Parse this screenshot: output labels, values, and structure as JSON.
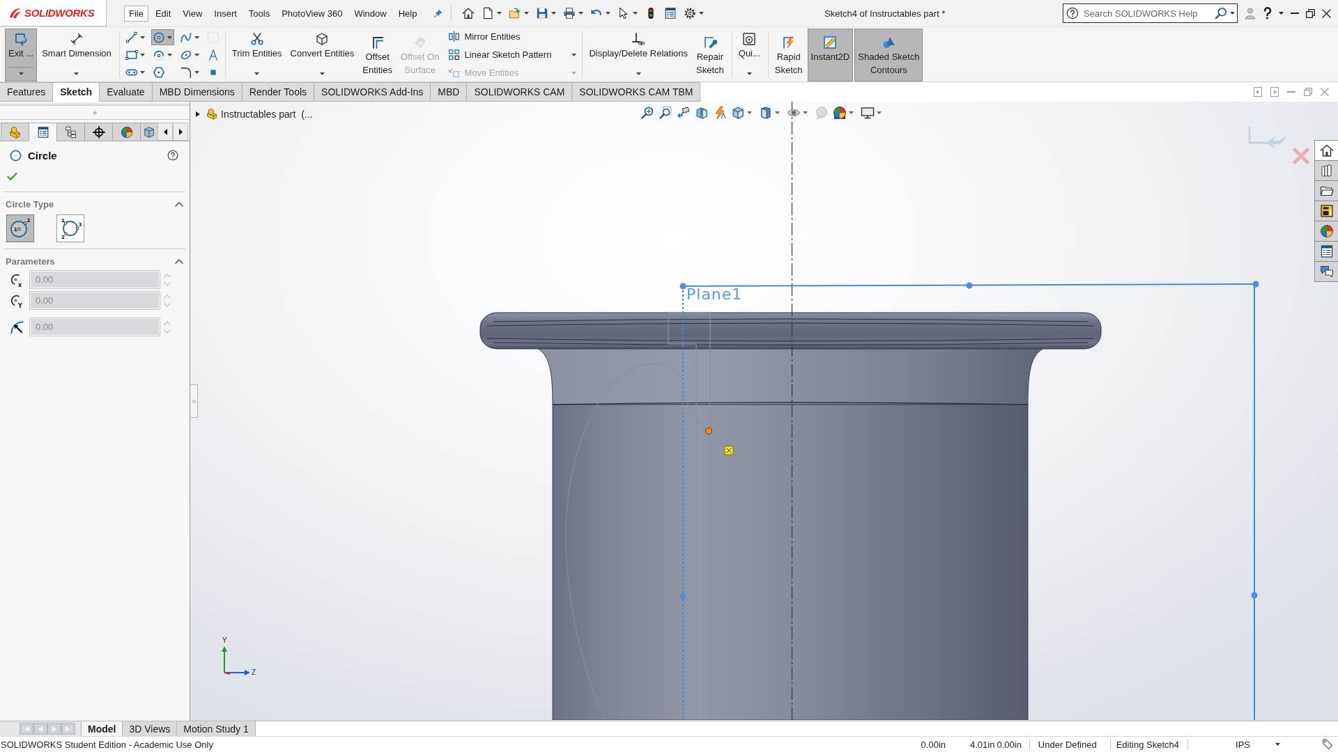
{
  "app": {
    "logo": "SOLIDWORKS"
  },
  "menu": [
    {
      "label": "File",
      "selected": true
    },
    {
      "label": "Edit",
      "selected": false
    },
    {
      "label": "View",
      "selected": false
    },
    {
      "label": "Insert",
      "selected": false
    },
    {
      "label": "Tools",
      "selected": false
    },
    {
      "label": "PhotoView 360",
      "selected": false
    },
    {
      "label": "Window",
      "selected": false
    },
    {
      "label": "Help",
      "selected": false
    }
  ],
  "window": {
    "title": "Sketch4 of Instructables part *"
  },
  "search": {
    "placeholder": "Search SOLIDWORKS Help"
  },
  "ribbon": [
    {
      "buttons": [
        {
          "kind": "exit",
          "lines": [
            "Exit ..."
          ],
          "active": true,
          "disabled": false,
          "dropdown": true
        },
        {
          "kind": "dimension",
          "lines": [
            "Smart Dimension"
          ],
          "active": false,
          "disabled": false,
          "dropdown": true
        }
      ]
    },
    {
      "tools": [
        {
          "kind": "line",
          "active": false,
          "disabled": false,
          "dropdown": true
        },
        {
          "kind": "circle",
          "active": true,
          "disabled": false,
          "dropdown": true
        },
        {
          "kind": "spline",
          "active": false,
          "disabled": false,
          "dropdown": true
        },
        {
          "kind": "construction",
          "active": false,
          "disabled": true,
          "dropdown": false
        },
        {
          "kind": "rectangle",
          "active": false,
          "disabled": false,
          "dropdown": true
        },
        {
          "kind": "arc",
          "active": false,
          "disabled": false,
          "dropdown": true
        },
        {
          "kind": "ellipse",
          "active": false,
          "disabled": false,
          "dropdown": true
        },
        {
          "kind": "text",
          "active": false,
          "disabled": false,
          "dropdown": false
        },
        {
          "kind": "slot",
          "active": false,
          "disabled": false,
          "dropdown": true
        },
        {
          "kind": "polygon",
          "active": false,
          "disabled": false,
          "dropdown": false
        },
        {
          "kind": "fillet",
          "active": false,
          "disabled": false,
          "dropdown": true
        },
        {
          "kind": "point",
          "active": false,
          "disabled": false,
          "dropdown": false
        }
      ]
    },
    {
      "buttons": [
        {
          "kind": "trim",
          "lines": [
            "Trim Entities"
          ],
          "active": false,
          "disabled": false,
          "dropdown": true
        },
        {
          "kind": "convert",
          "lines": [
            "Convert Entities"
          ],
          "active": false,
          "disabled": false,
          "dropdown": true
        },
        {
          "kind": "offset",
          "lines": [
            "Offset",
            "Entities"
          ],
          "active": false,
          "disabled": false,
          "dropdown": false
        },
        {
          "kind": "surface",
          "lines": [
            "Offset On",
            "Surface"
          ],
          "active": false,
          "disabled": true,
          "dropdown": false
        }
      ],
      "rows": [
        {
          "kind": "mirror",
          "label": "Mirror Entities",
          "disabled": false,
          "dropdown": false
        },
        {
          "kind": "pattern",
          "label": "Linear Sketch Pattern",
          "disabled": false,
          "dropdown": true
        },
        {
          "kind": "move",
          "label": "Move Entities",
          "disabled": true,
          "dropdown": true
        }
      ]
    },
    {
      "buttons": [
        {
          "kind": "relations",
          "lines": [
            "Display/Delete Relations"
          ],
          "active": false,
          "disabled": false,
          "dropdown": true
        },
        {
          "kind": "repair",
          "lines": [
            "Repair",
            "Sketch"
          ],
          "active": false,
          "disabled": false,
          "dropdown": false
        }
      ]
    },
    {
      "buttons": [
        {
          "kind": "snaps",
          "lines": [
            "Qui..."
          ],
          "active": false,
          "disabled": false,
          "dropdown": true
        }
      ]
    },
    {
      "buttons": [
        {
          "kind": "rapid",
          "lines": [
            "Rapid",
            "Sketch"
          ],
          "active": false,
          "disabled": false,
          "dropdown": false
        },
        {
          "kind": "instant",
          "lines": [
            "Instant2D"
          ],
          "active": true,
          "disabled": false,
          "dropdown": false
        },
        {
          "kind": "contours",
          "lines": [
            "Shaded Sketch",
            "Contours"
          ],
          "active": true,
          "disabled": false,
          "dropdown": false
        }
      ]
    }
  ],
  "tabs": [
    {
      "label": "Features",
      "selected": false
    },
    {
      "label": "Sketch",
      "selected": true
    },
    {
      "label": "Evaluate",
      "selected": false
    },
    {
      "label": "MBD Dimensions",
      "selected": false
    },
    {
      "label": "Render Tools",
      "selected": false
    },
    {
      "label": "SOLIDWORKS Add-Ins",
      "selected": false
    },
    {
      "label": "MBD",
      "selected": false
    },
    {
      "label": "SOLIDWORKS CAM",
      "selected": false
    },
    {
      "label": "SOLIDWORKS CAM TBM",
      "selected": false
    }
  ],
  "panel": {
    "tabs": [
      {
        "kind": "tree",
        "selected": false
      },
      {
        "kind": "property",
        "selected": true
      },
      {
        "kind": "configuration",
        "selected": false
      },
      {
        "kind": "dimxpert",
        "selected": false
      },
      {
        "kind": "appearance",
        "selected": false
      },
      {
        "kind": "display",
        "selected": false
      }
    ],
    "title": "Circle",
    "sections": [
      {
        "title": "Circle Type",
        "expanded": true,
        "options": [
          {
            "kind": "center",
            "selected": true,
            "points": [
              "1",
              "2"
            ]
          },
          {
            "kind": "perimeter",
            "selected": false,
            "points": [
              "1",
              "2",
              "3"
            ]
          }
        ]
      },
      {
        "title": "Parameters",
        "expanded": true,
        "fields": [
          {
            "kind": "center",
            "subscript": "x",
            "value": "0.00",
            "disabled": true
          },
          {
            "kind": "center",
            "subscript": "Y",
            "value": "0.00",
            "disabled": true
          },
          {
            "kind": "radius",
            "value": "0.00",
            "disabled": true
          }
        ]
      }
    ]
  },
  "tree": {
    "label": "Instructables part  (...",
    "expanded": false
  },
  "viewport": {
    "plane_label": "Plane1",
    "triad": {
      "y": "Y",
      "z": "Z"
    }
  },
  "task_pane": [
    {
      "kind": "home",
      "selected": true
    },
    {
      "kind": "library",
      "selected": false
    },
    {
      "kind": "explorer",
      "selected": false
    },
    {
      "kind": "palette",
      "selected": false
    },
    {
      "kind": "appearances",
      "selected": false
    },
    {
      "kind": "properties",
      "selected": false
    },
    {
      "kind": "forum",
      "selected": false
    }
  ],
  "bottom_tabs": [
    {
      "label": "Model",
      "selected": true
    },
    {
      "label": "3D Views",
      "selected": false
    },
    {
      "label": "Motion Study 1",
      "selected": false
    }
  ],
  "status_bar": {
    "edition": "SOLIDWORKS Student Edition - Academic Use Only",
    "readouts": [
      "0.00in",
      "4.01in",
      "0.00in"
    ],
    "sketch_state": "Under Defined",
    "editing": "Editing Sketch4",
    "units": "IPS"
  }
}
